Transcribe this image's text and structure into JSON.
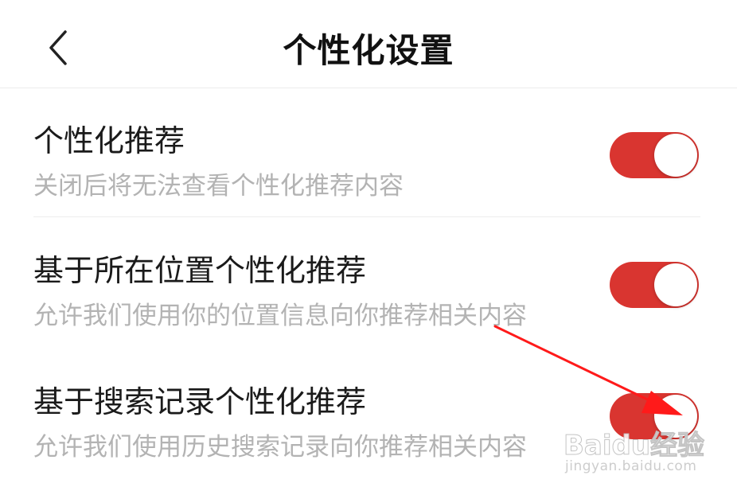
{
  "header": {
    "title": "个性化设置",
    "back_icon": "chevron-left-icon"
  },
  "settings": [
    {
      "title": "个性化推荐",
      "description": "关闭后将无法查看个性化推荐内容",
      "enabled": true
    },
    {
      "title": "基于所在位置个性化推荐",
      "description": "允许我们使用你的位置信息向你推荐相关内容",
      "enabled": true
    },
    {
      "title": "基于搜索记录个性化推荐",
      "description": "允许我们使用历史搜索记录向你推荐相关内容",
      "enabled": true
    }
  ],
  "colors": {
    "toggle_on": "#d93530",
    "annotation_arrow": "#ff1a1a",
    "description_text": "#b3b3b3"
  },
  "watermark": {
    "brand": "Baidu经验",
    "url": "jingyan.baidu.com"
  }
}
